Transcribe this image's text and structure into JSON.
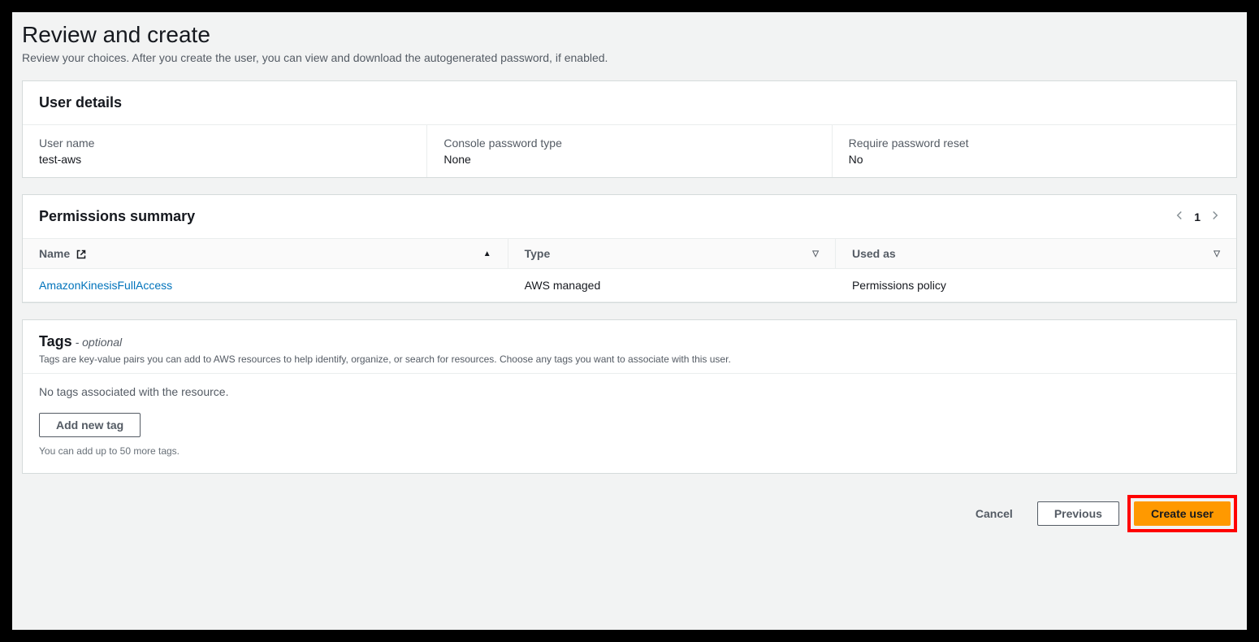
{
  "page": {
    "title": "Review and create",
    "subtitle": "Review your choices. After you create the user, you can view and download the autogenerated password, if enabled."
  },
  "userDetails": {
    "heading": "User details",
    "fields": {
      "userName": {
        "label": "User name",
        "value": "test-aws"
      },
      "passwordType": {
        "label": "Console password type",
        "value": "None"
      },
      "requireReset": {
        "label": "Require password reset",
        "value": "No"
      }
    }
  },
  "permissions": {
    "heading": "Permissions summary",
    "pagination": {
      "current": "1"
    },
    "columns": {
      "name": "Name",
      "type": "Type",
      "usedAs": "Used as"
    },
    "rows": [
      {
        "name": "AmazonKinesisFullAccess",
        "type": "AWS managed",
        "usedAs": "Permissions policy"
      }
    ]
  },
  "tags": {
    "heading": "Tags",
    "optional": " - optional",
    "description": "Tags are key-value pairs you can add to AWS resources to help identify, organize, or search for resources. Choose any tags you want to associate with this user.",
    "emptyMessage": "No tags associated with the resource.",
    "addButton": "Add new tag",
    "limitText": "You can add up to 50 more tags."
  },
  "footer": {
    "cancel": "Cancel",
    "previous": "Previous",
    "create": "Create user"
  }
}
